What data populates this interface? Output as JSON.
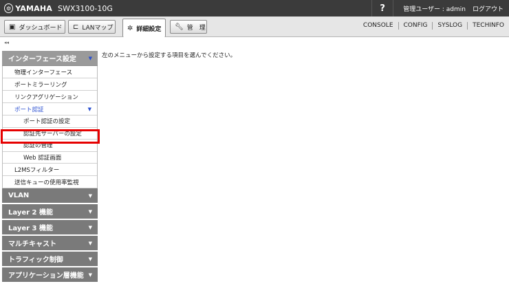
{
  "header": {
    "brand": "YAMAHA",
    "model": "SWX3100-10G",
    "help": "?",
    "user": "管理ユーザー : admin",
    "logout": "ログアウト"
  },
  "tabs": [
    {
      "label": "ダッシュボード",
      "icon": "dashboard-icon"
    },
    {
      "label": "LANマップ",
      "icon": "lanmap-icon"
    },
    {
      "label": "詳細設定",
      "icon": "gear-icon"
    },
    {
      "label": "管　理",
      "icon": "wrench-icon"
    }
  ],
  "links": [
    "CONSOLE",
    "CONFIG",
    "SYSLOG",
    "TECHINFO"
  ],
  "collapse": "◂◂",
  "sidebar": {
    "open_section": "インターフェース設定",
    "items": [
      "物理インターフェース",
      "ポートミラーリング",
      "リンクアグリゲーション",
      "ポート認証",
      "ポート認証の設定",
      "認証先サーバーの設定",
      "認証の管理",
      "Web 認証画面",
      "L2MSフィルター",
      "送信キューの使用率監視"
    ],
    "sections": [
      "VLAN",
      "Layer 2 機能",
      "Layer 3 機能",
      "マルチキャスト",
      "トラフィック制御",
      "アプリケーション層機能"
    ]
  },
  "content": {
    "message": "左のメニューから設定する項目を選んでください。"
  }
}
